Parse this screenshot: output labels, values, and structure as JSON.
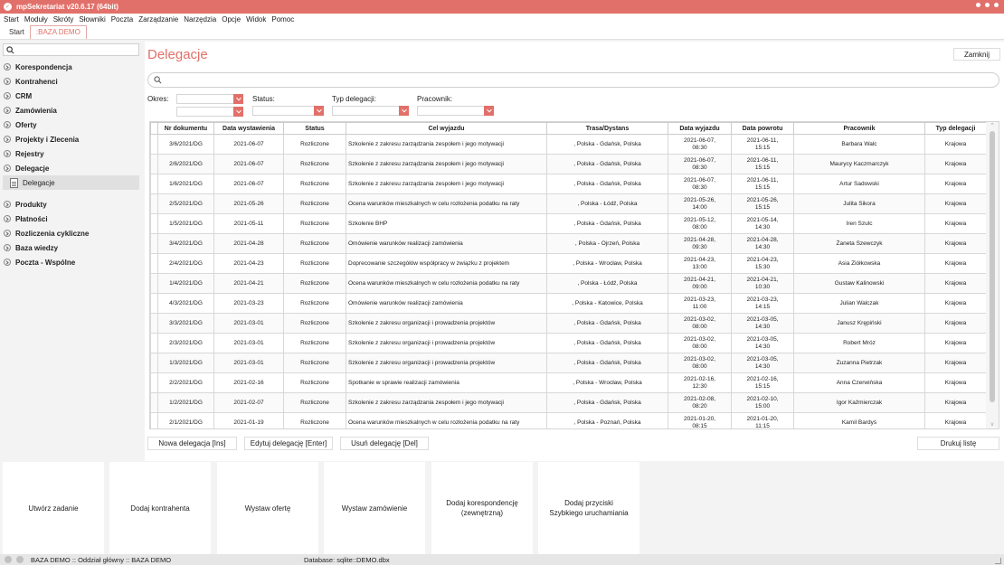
{
  "window": {
    "title": "mpSekretariat v20.6.17 (64bit)"
  },
  "menu": [
    "Start",
    "Moduły",
    "Skróty",
    "Słowniki",
    "Poczta",
    "Zarządzanie",
    "Narzędzia",
    "Opcje",
    "Widok",
    "Pomoc"
  ],
  "tabs": [
    {
      "label": "Start"
    },
    {
      "label": ":BAZA DEMO"
    }
  ],
  "sidebar": {
    "search_placeholder": "",
    "items": [
      {
        "label": "Korespondencja"
      },
      {
        "label": "Kontrahenci"
      },
      {
        "label": "CRM"
      },
      {
        "label": "Zamówienia"
      },
      {
        "label": "Oferty"
      },
      {
        "label": "Projekty i Zlecenia"
      },
      {
        "label": "Rejestry"
      },
      {
        "label": "Delegacje"
      }
    ],
    "sub_item": {
      "label": "Delegacje"
    },
    "items2": [
      {
        "label": "Produkty"
      },
      {
        "label": "Płatności"
      },
      {
        "label": "Rozliczenia cykliczne"
      },
      {
        "label": "Baza wiedzy"
      },
      {
        "label": "Poczta - Wspólne"
      }
    ]
  },
  "main": {
    "title": "Delegacje",
    "close_label": "Zamknij",
    "search_placeholder": "",
    "filters": {
      "okres": "Okres:",
      "status": "Status:",
      "typ": "Typ delegacji:",
      "pracownik": "Pracownik:"
    }
  },
  "table": {
    "columns": [
      "Nr dokumentu",
      "Data wystawienia",
      "Status",
      "Cel wyjazdu",
      "Trasa/Dystans",
      "Data wyjazdu",
      "Data powrotu",
      "Pracownik",
      "Typ delegacji"
    ],
    "rows": [
      [
        "3/6/2021/DG",
        "2021-06-07",
        "Rozliczone",
        "Szkolenie z zakresu zarządzania zespołem i jego motywacji",
        ", Polska - Gdańsk, Polska",
        "2021-06-07,",
        "08:30",
        "2021-06-11,",
        "15:15",
        "Barbara Walc",
        "Krajowa"
      ],
      [
        "2/6/2021/DG",
        "2021-06-07",
        "Rozliczone",
        "Szkolenie z zakresu zarządzania zespołem i jego motywacji",
        ", Polska - Gdańsk, Polska",
        "2021-06-07,",
        "08:30",
        "2021-06-11,",
        "15:15",
        "Maurycy Kaczmarczyk",
        "Krajowa"
      ],
      [
        "1/6/2021/DG",
        "2021-06-07",
        "Rozliczone",
        "Szkolenie z zakresu zarządzania zespołem i jego motywacji",
        ", Polska - Gdańsk, Polska",
        "2021-06-07,",
        "08:30",
        "2021-06-11,",
        "15:15",
        "Artur Sadowski",
        "Krajowa"
      ],
      [
        "2/5/2021/DG",
        "2021-05-26",
        "Rozliczone",
        "Ocena warunków mieszkalnych w celu rozłożenia podatku na raty",
        ", Polska - Łódź, Polska",
        "2021-05-26,",
        "14:00",
        "2021-05-26,",
        "15:15",
        "Julita Sikora",
        "Krajowa"
      ],
      [
        "1/5/2021/DG",
        "2021-05-11",
        "Rozliczone",
        "Szkolenie BHP",
        ", Polska - Gdańsk, Polska",
        "2021-05-12,",
        "08:00",
        "2021-05-14,",
        "14:30",
        "Iren Szulc",
        "Krajowa"
      ],
      [
        "3/4/2021/DG",
        "2021-04-28",
        "Rozliczone",
        "Omówienie warunków realizacji zamówienia",
        ", Polska - Ojrzeń, Polska",
        "2021-04-28,",
        "09:30",
        "2021-04-28,",
        "14:30",
        "Żaneta Szewczyk",
        "Krajowa"
      ],
      [
        "2/4/2021/DG",
        "2021-04-23",
        "Rozliczone",
        "Doprecowanie szczegółów współpracy w związku z projektem",
        ", Polska - Wrocław, Polska",
        "2021-04-23,",
        "13:00",
        "2021-04-23,",
        "15:30",
        "Asia Ziółkowska",
        "Krajowa"
      ],
      [
        "1/4/2021/DG",
        "2021-04-21",
        "Rozliczone",
        "Ocena warunków mieszkalnych w celu rozłożenia podatku na raty",
        ", Polska - Łódź, Polska",
        "2021-04-21,",
        "09:00",
        "2021-04-21,",
        "10:30",
        "Gustaw Kalinowski",
        "Krajowa"
      ],
      [
        "4/3/2021/DG",
        "2021-03-23",
        "Rozliczone",
        "Omówienie warunków realizacji zamówienia",
        ", Polska - Katowice, Polska",
        "2021-03-23,",
        "11:00",
        "2021-03-23,",
        "14:15",
        "Julian Walczak",
        "Krajowa"
      ],
      [
        "3/3/2021/DG",
        "2021-03-01",
        "Rozliczone",
        "Szkolenie z zakresu organizacji i prowadzenia projektów",
        ", Polska - Gdańsk, Polska",
        "2021-03-02,",
        "08:00",
        "2021-03-05,",
        "14:30",
        "Janusz Krępiński",
        "Krajowa"
      ],
      [
        "2/3/2021/DG",
        "2021-03-01",
        "Rozliczone",
        "Szkolenie z zakresu organizacji i prowadzenia projektów",
        ", Polska - Gdańsk, Polska",
        "2021-03-02,",
        "08:00",
        "2021-03-05,",
        "14:30",
        "Robert Mróz",
        "Krajowa"
      ],
      [
        "1/3/2021/DG",
        "2021-03-01",
        "Rozliczone",
        "Szkolenie z zakresu organizacji i prowadzenia projektów",
        ", Polska - Gdańsk, Polska",
        "2021-03-02,",
        "08:00",
        "2021-03-05,",
        "14:30",
        "Zuzanna Pietrzak",
        "Krajowa"
      ],
      [
        "2/2/2021/DG",
        "2021-02-16",
        "Rozliczone",
        "Spotkanie w sprawie realizacji zamówienia",
        ", Polska - Wrocław, Polska",
        "2021-02-16,",
        "12:30",
        "2021-02-16,",
        "15:15",
        "Anna Czerwińska",
        "Krajowa"
      ],
      [
        "1/2/2021/DG",
        "2021-02-07",
        "Rozliczone",
        "Szkolenie z zakresu zarządzania zespołem i jego motywacji",
        ", Polska - Gdańsk, Polska",
        "2021-02-08,",
        "08:20",
        "2021-02-10,",
        "15:00",
        "Igor Kaźmierczak",
        "Krajowa"
      ],
      [
        "2/1/2021/DG",
        "2021-01-19",
        "Rozliczone",
        "Ocena warunków mieszkalnych w celu rozłożenia podatku na raty",
        ", Polska - Poznań, Polska",
        "2021-01-20,",
        "08:15",
        "2021-01-20,",
        "11:15",
        "Kamil Bardyś",
        "Krajowa"
      ]
    ]
  },
  "actions": {
    "new": "Nowa delegacja [Ins]",
    "edit": "Edytuj delegację [Enter]",
    "delete": "Usuń delegację [Del]",
    "print": "Drukuj listę"
  },
  "tiles": [
    {
      "label": "Utwórz zadanie"
    },
    {
      "label": "Dodaj kontrahenta"
    },
    {
      "label": "Wystaw ofertę"
    },
    {
      "label": "Wystaw zamówienie"
    },
    {
      "label": "Dodaj korespondencję\n(zewnętrzną)"
    },
    {
      "label": "Dodaj przyciski\nSzybkiego uruchamiania"
    }
  ],
  "status": {
    "office": "BAZA DEMO :: Oddział główny :: BAZA DEMO",
    "database": "Database: sqlite::DEMO.dbx"
  },
  "colors": {
    "accent": "#e2706a"
  }
}
